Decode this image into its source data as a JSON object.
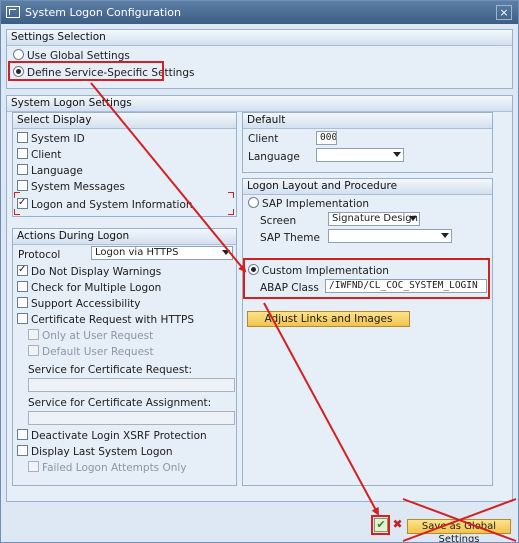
{
  "window": {
    "title": "System Logon Configuration",
    "close_label": "×"
  },
  "settings_selection": {
    "title": "Settings Selection",
    "use_global": "Use Global Settings",
    "define_specific": "Define Service-Specific Settings"
  },
  "system_logon": {
    "title": "System Logon Settings"
  },
  "select_display": {
    "title": "Select Display",
    "items": [
      {
        "label": "System ID",
        "checked": false
      },
      {
        "label": "Client",
        "checked": false
      },
      {
        "label": "Language",
        "checked": false
      },
      {
        "label": "System Messages",
        "checked": false
      },
      {
        "label": "Logon and System Information",
        "checked": true
      }
    ]
  },
  "default": {
    "title": "Default",
    "client_label": "Client",
    "client_value": "000",
    "language_label": "Language",
    "language_value": ""
  },
  "actions": {
    "title": "Actions During Logon",
    "protocol_label": "Protocol",
    "protocol_value": "Logon via HTTPS",
    "do_not_display_warnings": "Do Not Display Warnings",
    "check_multiple_logon": "Check for Multiple Logon",
    "support_accessibility": "Support Accessibility",
    "certificate_request": "Certificate Request with HTTPS",
    "only_at_user_request": "Only at User Request",
    "default_user_request": "Default User Request",
    "service_cert_request_label": "Service for Certificate Request:",
    "service_cert_request_value": "",
    "service_cert_assignment_label": "Service for Certificate Assignment:",
    "service_cert_assignment_value": "",
    "deactivate_xsrf": "Deactivate Login XSRF Protection",
    "display_last_logon": "Display Last System Logon",
    "failed_attempts_only": "Failed Logon Attempts Only"
  },
  "layout": {
    "title": "Logon Layout and Procedure",
    "sap_implementation": "SAP Implementation",
    "screen_label": "Screen",
    "screen_value": "Signature Design",
    "theme_label": "SAP Theme",
    "theme_value": "",
    "custom_implementation": "Custom Implementation",
    "abap_class_label": "ABAP Class",
    "abap_class_value": "/IWFND/CL_COC_SYSTEM_LOGIN",
    "adjust_button": "Adjust Links and Images"
  },
  "footer": {
    "ok_symbol": "✔",
    "cancel_symbol": "✖",
    "save_global": "Save as Global Settings"
  },
  "colors": {
    "annotation_red": "#d52020",
    "title_bar": "#4a6b93",
    "panel_bg": "#e6eef8",
    "button_yellow": "#f2c34e"
  }
}
